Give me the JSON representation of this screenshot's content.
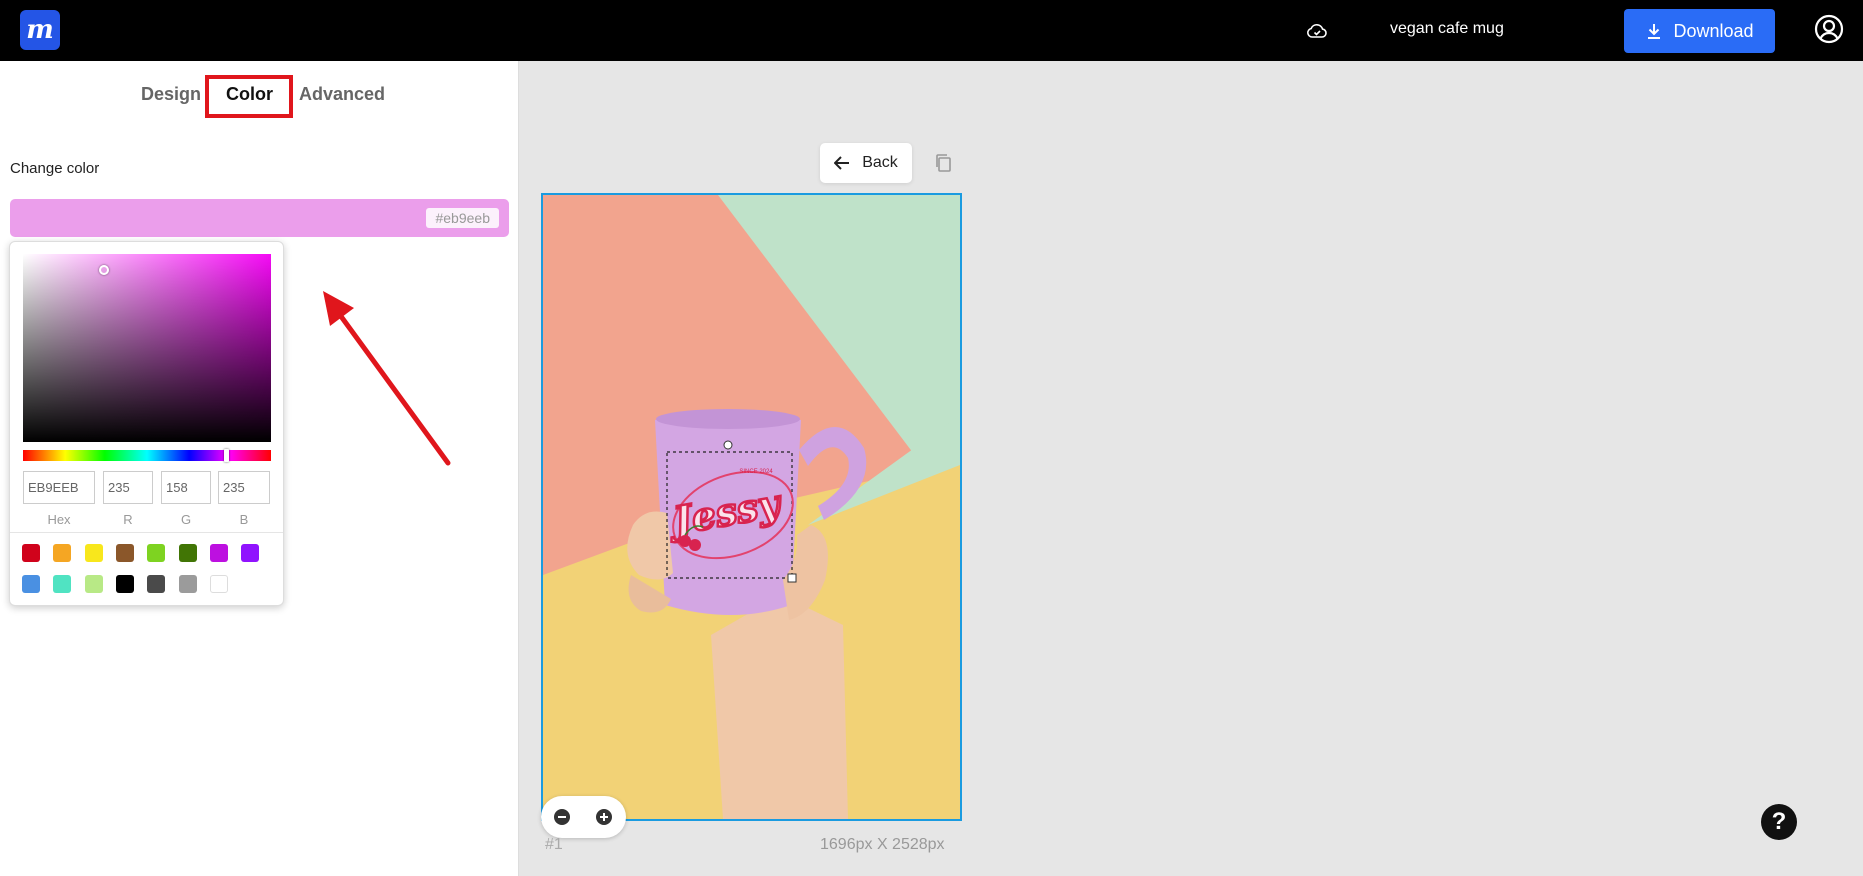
{
  "app": {
    "logo_letter": "m"
  },
  "header": {
    "doc_title": "vegan cafe mug",
    "download_label": "Download"
  },
  "tabs": [
    {
      "label": "Design"
    },
    {
      "label": "Color",
      "active": true
    },
    {
      "label": "Advanced"
    }
  ],
  "color_panel": {
    "heading": "Change color",
    "current_hex": "#eb9eeb",
    "current_color": "#eb9eeb",
    "picker": {
      "hex_value": "EB9EEB",
      "r_value": "235",
      "g_value": "158",
      "b_value": "235",
      "hex_label": "Hex",
      "r_label": "R",
      "g_label": "G",
      "b_label": "B",
      "swatches_row1": [
        "#d0021b",
        "#f5a623",
        "#f8e71c",
        "#8b572a",
        "#7ed321",
        "#417505",
        "#bd10e0",
        "#9013fe"
      ],
      "swatches_row2": [
        "#4a90e2",
        "#50e3c2",
        "#b8e986",
        "#000000",
        "#4a4a4a",
        "#9b9b9b",
        "#ffffff"
      ]
    }
  },
  "canvas": {
    "back_label": "Back",
    "mug_text": "Jessy",
    "mug_subtext": "SINCE 2024",
    "page_number": "#1",
    "dimensions": "1696px X 2528px"
  },
  "help": {
    "label": "?"
  }
}
